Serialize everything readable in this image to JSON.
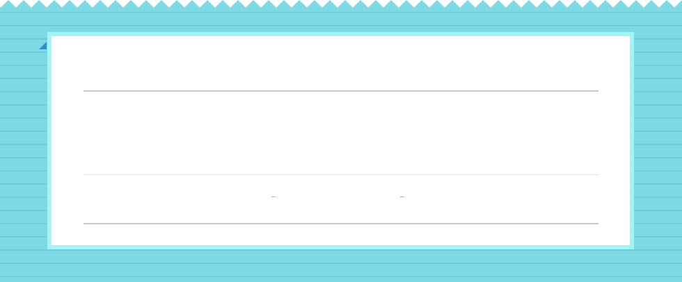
{
  "theme": {
    "background": "#7dd9e3",
    "stripe": "#6fcdd9",
    "card_border": "#9ff6f6",
    "card_fill": "#ffffff",
    "corner_tab": "#2f8fc9",
    "rule": "#c9c9c9"
  },
  "card": {
    "empty_cells": [
      {
        "text": "–"
      },
      {
        "text": "–"
      }
    ]
  }
}
